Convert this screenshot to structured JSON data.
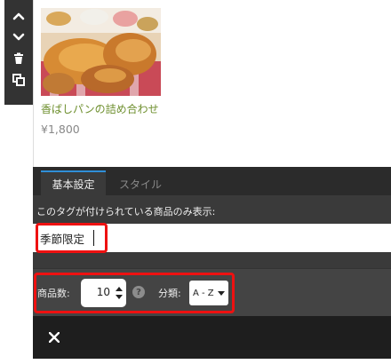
{
  "toolbar": {
    "buttons": [
      {
        "name": "move-up",
        "icon": "chevron-up-icon"
      },
      {
        "name": "move-down",
        "icon": "chevron-down-icon"
      },
      {
        "name": "delete",
        "icon": "trash-icon"
      },
      {
        "name": "duplicate",
        "icon": "copy-icon"
      }
    ]
  },
  "product": {
    "name": "香ばしパンの詰め合わせ",
    "price": "¥1,800",
    "image": "bread-assortment-photo"
  },
  "tabs": {
    "basic": "基本設定",
    "style": "スタイル",
    "active": "basic"
  },
  "basic_settings": {
    "tag_label": "このタグが付けられている商品のみ表示:",
    "tag_value": "季節限定"
  },
  "counts": {
    "count_label": "商品数:",
    "count_value": "10",
    "category_label": "分類:",
    "category_value": "A - Z"
  },
  "footer": {
    "close_icon": "close-icon"
  },
  "colors": {
    "accent": "#2f8fd8",
    "highlight": "#ee1111",
    "product_name": "#6e8f2e",
    "panel_bg": "#3a3a3a",
    "footer_bg": "#1e1e1e"
  }
}
